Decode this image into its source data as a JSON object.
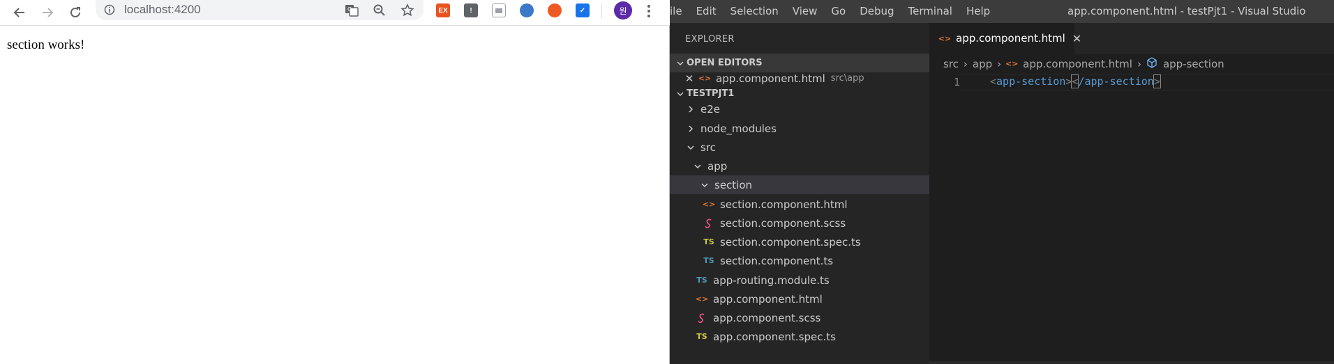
{
  "browser": {
    "url": "localhost:4200",
    "page_text": "section works!",
    "avatar_letter": "원",
    "extensions": [
      {
        "name": "ex-extension-icon",
        "label": "EX",
        "color": "#e8531f"
      },
      {
        "name": "exclamation-extension-icon",
        "label": "!",
        "color": "#5f6368"
      },
      {
        "name": "screen-extension-icon",
        "label": "",
        "color": "#9aa0a6"
      },
      {
        "name": "circle-extension-icon",
        "label": "",
        "color": "#3b78c9"
      },
      {
        "name": "rocket-extension-icon",
        "label": "",
        "color": "#ee5a24"
      },
      {
        "name": "check-extension-icon",
        "label": "",
        "color": "#1a73e8"
      }
    ]
  },
  "vscode": {
    "menu": [
      "ile",
      "Edit",
      "Selection",
      "View",
      "Go",
      "Debug",
      "Terminal",
      "Help"
    ],
    "window_title": "app.component.html - testPjt1 - Visual Studio Code",
    "explorer_title": "EXPLORER",
    "open_editors_header": "OPEN EDITORS",
    "open_editor": {
      "name": "app.component.html",
      "path": "src\\app"
    },
    "project_header": "TESTPJT1",
    "tree": {
      "e2e": "e2e",
      "node_modules": "node_modules",
      "src": "src",
      "app": "app",
      "section": "section",
      "section_html": "section.component.html",
      "section_scss": "section.component.scss",
      "section_spec": "section.component.spec.ts",
      "section_ts": "section.component.ts",
      "app_routing": "app-routing.module.ts",
      "app_html": "app.component.html",
      "app_scss": "app.component.scss",
      "app_spec": "app.component.spec.ts"
    },
    "tab": {
      "name": "app.component.html"
    },
    "breadcrumbs": {
      "src": "src",
      "app": "app",
      "file": "app.component.html",
      "symbol": "app-section"
    },
    "editor": {
      "line_number": "1",
      "code": {
        "open_lt": "<",
        "open_tag": "app-section",
        "open_gt": ">",
        "close_lt": "<",
        "close_slash_tag": "/app-section",
        "close_gt": ">"
      }
    },
    "icons": {
      "ts": "TS",
      "html": "<>"
    }
  }
}
